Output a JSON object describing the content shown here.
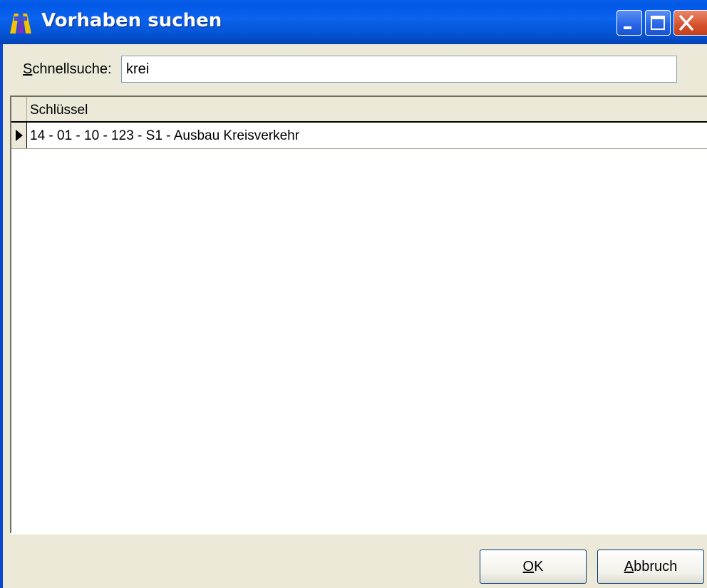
{
  "window": {
    "title": "Vorhaben suchen",
    "app_icon_name": "niss-app-icon",
    "controls": {
      "minimize_icon": "minimize-icon",
      "maximize_icon": "maximize-icon",
      "close_icon": "close-icon"
    }
  },
  "search": {
    "label_accel": "S",
    "label_rest": "chnellsuche:",
    "value": "krei"
  },
  "grid": {
    "columns": [
      "Schlüssel"
    ],
    "rows": [
      {
        "key": "14 - 01 - 10 - 123 - S1 - Ausbau Kreisverkehr",
        "current": true
      }
    ]
  },
  "buttons": {
    "ok": {
      "accel": "O",
      "rest": "K"
    },
    "cancel": {
      "accel": "A",
      "rest": "bbruch"
    }
  },
  "colors": {
    "titlebar": "#0058e6",
    "face": "#ece9d8",
    "close": "#d6502b"
  }
}
